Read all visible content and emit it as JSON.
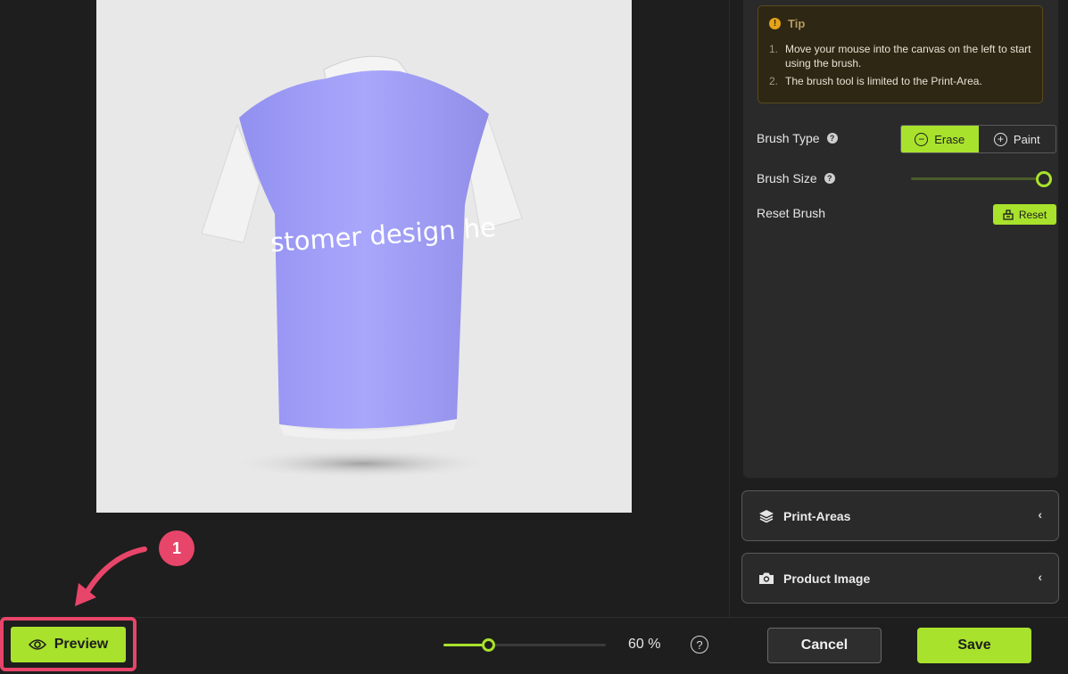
{
  "canvas": {
    "design_text": "stomer design he",
    "shirt_color": "#9e9cf8"
  },
  "tip": {
    "title": "Tip",
    "items": [
      {
        "num": "1.",
        "text": "Move your mouse into the canvas on the left to start using the brush."
      },
      {
        "num": "2.",
        "text": "The brush tool is limited to the Print-Area."
      }
    ]
  },
  "brush": {
    "type_label": "Brush Type",
    "erase_label": "Erase",
    "paint_label": "Paint",
    "active": "Erase",
    "size_label": "Brush Size",
    "size_value": 1.0,
    "reset_label": "Reset Brush",
    "reset_button": "Reset"
  },
  "accordions": {
    "print_areas": "Print-Areas",
    "product_image": "Product Image"
  },
  "footer": {
    "preview_label": "Preview",
    "zoom_value": "60 %",
    "zoom_help": "?",
    "cancel_label": "Cancel",
    "save_label": "Save"
  },
  "annotation": {
    "step_number": "1"
  },
  "colors": {
    "accent": "#a8e22c",
    "highlight": "#e8456a",
    "panel": "#2a2a2a",
    "background": "#1e1e1e"
  }
}
